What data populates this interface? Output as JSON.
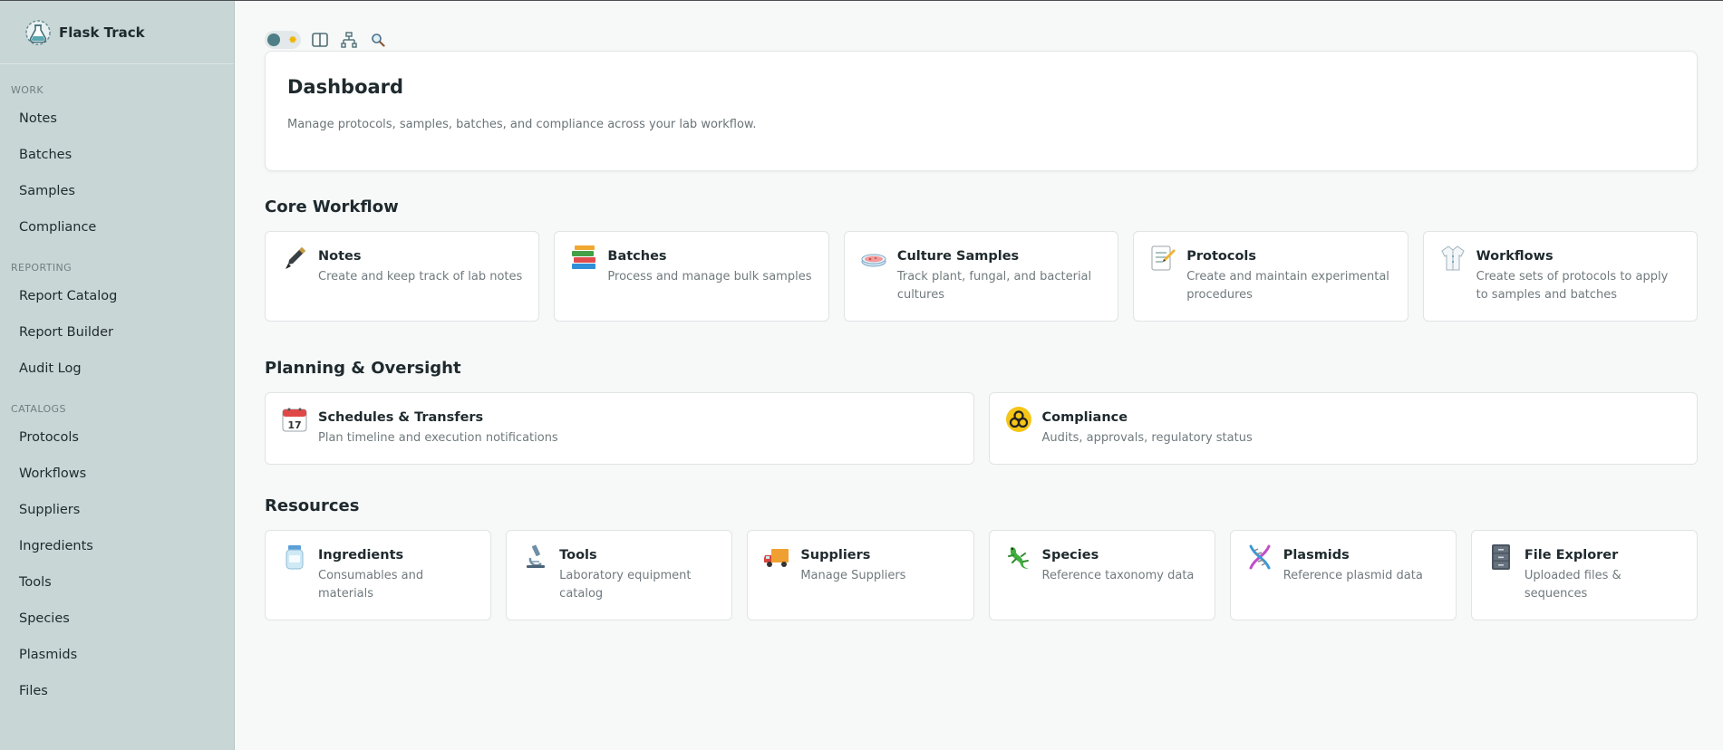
{
  "brand": {
    "name": "Flask Track",
    "icon": "flask-logo-icon"
  },
  "sidebar": {
    "sections": [
      {
        "label": "WORK",
        "items": [
          "Notes",
          "Batches",
          "Samples",
          "Compliance"
        ]
      },
      {
        "label": "REPORTING",
        "items": [
          "Report Catalog",
          "Report Builder",
          "Audit Log"
        ]
      },
      {
        "label": "CATALOGS",
        "items": [
          "Protocols",
          "Workflows",
          "Suppliers",
          "Ingredients",
          "Tools",
          "Species",
          "Plasmids",
          "Files"
        ]
      }
    ]
  },
  "toolbar": {
    "icons": [
      "theme-toggle",
      "split-view-icon",
      "network-icon",
      "search-icon"
    ]
  },
  "hero": {
    "title": "Dashboard",
    "subtitle": "Manage protocols, samples, batches, and compliance across your lab workflow."
  },
  "sections": {
    "core": {
      "title": "Core Workflow",
      "cards": [
        {
          "title": "Notes",
          "desc": "Create and keep track of lab notes",
          "icon": "pen-icon"
        },
        {
          "title": "Batches",
          "desc": "Process and manage bulk samples",
          "icon": "books-icon"
        },
        {
          "title": "Culture Samples",
          "desc": "Track plant, fungal, and bacterial cultures",
          "icon": "petri-dish-icon"
        },
        {
          "title": "Protocols",
          "desc": "Create and maintain experimental procedures",
          "icon": "memo-icon"
        },
        {
          "title": "Workflows",
          "desc": "Create sets of protocols to apply to samples and batches",
          "icon": "lab-coat-icon"
        }
      ]
    },
    "planning": {
      "title": "Planning & Oversight",
      "cards": [
        {
          "title": "Schedules & Transfers",
          "desc": "Plan timeline and execution notifications",
          "icon": "calendar-icon",
          "icon_text": "17"
        },
        {
          "title": "Compliance",
          "desc": "Audits, approvals, regulatory status",
          "icon": "biohazard-icon"
        }
      ]
    },
    "resources": {
      "title": "Resources",
      "cards": [
        {
          "title": "Ingredients",
          "desc": "Consumables and materials",
          "icon": "jar-icon"
        },
        {
          "title": "Tools",
          "desc": "Laboratory equipment catalog",
          "icon": "microscope-icon"
        },
        {
          "title": "Suppliers",
          "desc": "Manage Suppliers",
          "icon": "delivery-truck-icon"
        },
        {
          "title": "Species",
          "desc": "Reference taxonomy data",
          "icon": "lizard-icon"
        },
        {
          "title": "Plasmids",
          "desc": "Reference plasmid data",
          "icon": "dna-icon"
        },
        {
          "title": "File Explorer",
          "desc": "Uploaded files & sequences",
          "icon": "file-cabinet-icon"
        }
      ]
    }
  }
}
